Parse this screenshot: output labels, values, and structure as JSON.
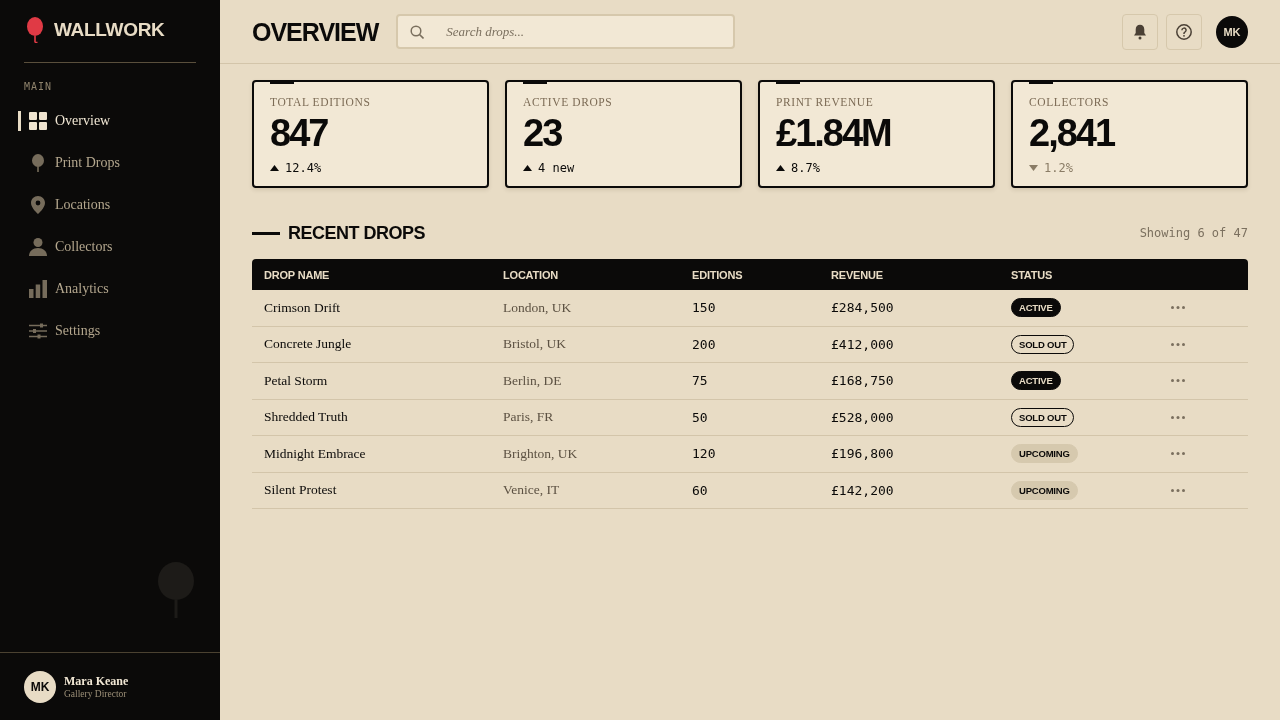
{
  "sidebar": {
    "brand": "WALLWORK",
    "section_label": "MAIN",
    "items": [
      {
        "label": "Overview",
        "selected": true
      },
      {
        "label": "Print Drops",
        "selected": false
      },
      {
        "label": "Locations",
        "selected": false
      },
      {
        "label": "Collectors",
        "selected": false
      },
      {
        "label": "Analytics",
        "selected": false
      },
      {
        "label": "Settings",
        "selected": false
      }
    ],
    "user": {
      "initials": "MK",
      "name": "Mara Keane",
      "role": "Gallery Director"
    }
  },
  "header": {
    "title": "OVERVIEW",
    "search": {
      "placeholder": "Search drops..."
    },
    "avatar_initials": "MK"
  },
  "stats": [
    {
      "label": "TOTAL EDITIONS",
      "value": "847",
      "change": "12.4%",
      "rising": true
    },
    {
      "label": "ACTIVE DROPS",
      "value": "23",
      "change": "4 new",
      "rising": true
    },
    {
      "label": "PRINT REVENUE",
      "value": "£1.84M",
      "change": "8.7%",
      "rising": true
    },
    {
      "label": "COLLECTORS",
      "value": "2,841",
      "change": "1.2%",
      "rising": false
    }
  ],
  "recent_drops": {
    "title": "RECENT DROPS",
    "count": "Showing 6 of 47",
    "columns": [
      "DROP NAME",
      "LOCATION",
      "EDITIONS",
      "REVENUE",
      "STATUS"
    ],
    "rows": [
      {
        "name": "Crimson Drift",
        "location": "London, UK",
        "editions": "150",
        "revenue": "£284,500",
        "status": {
          "label": "ACTIVE",
          "kind": "active"
        }
      },
      {
        "name": "Concrete Jungle",
        "location": "Bristol, UK",
        "editions": "200",
        "revenue": "£412,000",
        "status": {
          "label": "SOLD OUT",
          "kind": "soldout"
        }
      },
      {
        "name": "Petal Storm",
        "location": "Berlin, DE",
        "editions": "75",
        "revenue": "£168,750",
        "status": {
          "label": "ACTIVE",
          "kind": "active"
        }
      },
      {
        "name": "Shredded Truth",
        "location": "Paris, FR",
        "editions": "50",
        "revenue": "£528,000",
        "status": {
          "label": "SOLD OUT",
          "kind": "soldout"
        }
      },
      {
        "name": "Midnight Embrace",
        "location": "Brighton, UK",
        "editions": "120",
        "revenue": "£196,800",
        "status": {
          "label": "UPCOMING",
          "kind": "upcoming"
        }
      },
      {
        "name": "Silent Protest",
        "location": "Venice, IT",
        "editions": "60",
        "revenue": "£142,200",
        "status": {
          "label": "UPCOMING",
          "kind": "upcoming"
        }
      }
    ]
  }
}
